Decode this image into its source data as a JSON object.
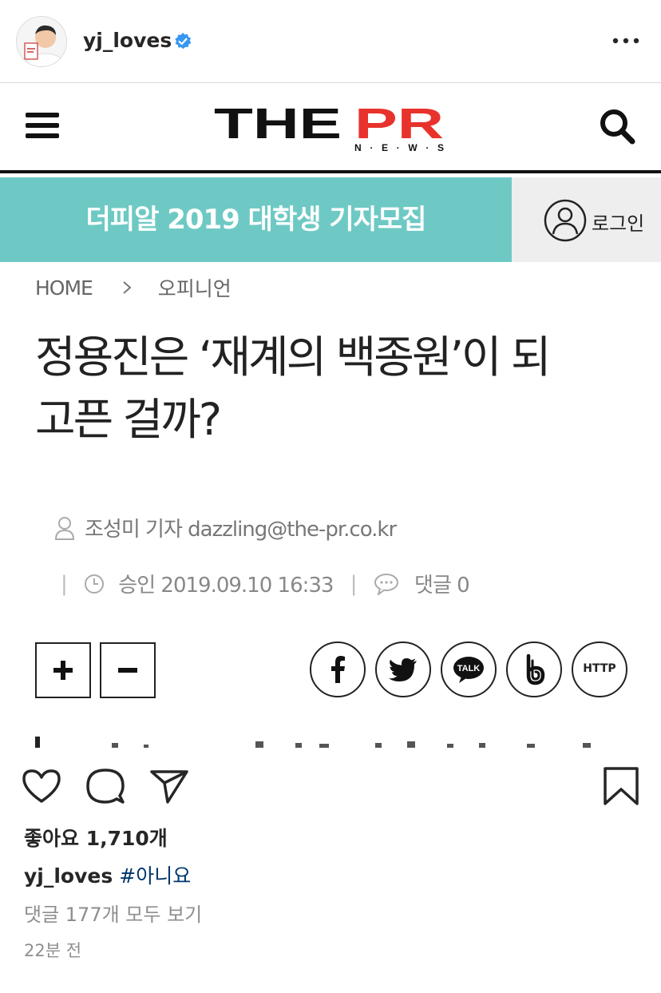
{
  "post": {
    "username": "yj_loves",
    "verified": true
  },
  "article": {
    "logo_main": "THE",
    "logo_accent": "PR",
    "logo_sub": "N · E · W · S",
    "banner": "더피알 2019 대학생 기자모집",
    "login": "로그인",
    "breadcrumb_home": "HOME",
    "breadcrumb_section": "오피니언",
    "headline_line1": "정용진은 ‘재계의 백종원’이 되",
    "headline_line2": "고픈 걸까?",
    "byline": "조성미 기자 dazzling@the-pr.co.kr",
    "approved": "승인 2019.09.10 16:33",
    "comments": "댓글 0",
    "share_talk": "TALK",
    "share_http": "HTTP"
  },
  "engagement": {
    "likes": "좋아요 1,710개",
    "caption_user": "yj_loves",
    "caption_tag": "#아니요",
    "view_comments": "댓글 177개 모두 보기",
    "time_ago": "22분 전"
  },
  "colors": {
    "banner": "#6ec9c4",
    "logo_accent": "#e8322c",
    "verified": "#3897f0",
    "hashtag": "#00376b"
  }
}
